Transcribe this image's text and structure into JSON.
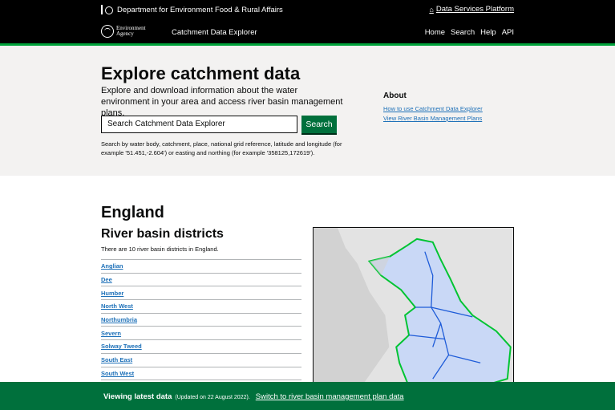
{
  "top_bar": {
    "department": "Department for Environment Food & Rural Affairs",
    "platform_link": "Data Services Platform"
  },
  "header": {
    "logo_text_line1": "Environment",
    "logo_text_line2": "Agency",
    "service_name": "Catchment Data Explorer",
    "nav": [
      "Home",
      "Search",
      "Help",
      "API"
    ]
  },
  "hero": {
    "title": "Explore catchment data",
    "lead": "Explore and download information about the water environment in your area and access river basin management plans.",
    "search_placeholder": "Search Catchment Data Explorer",
    "search_button": "Search",
    "hint": "Search by water body, catchment, place, national grid reference, latitude and longitude (for example '51.451,-2.604') or easting and northing (for example '358125,172619').",
    "about": {
      "title": "About",
      "links": [
        "How to use Catchment Data Explorer",
        "View River Basin Management Plans"
      ]
    }
  },
  "england": {
    "title": "England",
    "rbd_title": "River basin districts",
    "rbd_count": "There are 10 river basin districts in England.",
    "districts": [
      "Anglian",
      "Dee",
      "Humber",
      "North West",
      "Northumbria",
      "Severn",
      "Solway Tweed",
      "South East",
      "South West"
    ]
  },
  "banner": {
    "status": "Viewing latest data",
    "updated": "(Updated on 22 August 2022).",
    "switch_link": "Switch to river basin management plan data"
  },
  "colors": {
    "green": "#00703c",
    "link": "#1d70b8",
    "map_outline": "#00a33b",
    "map_rbd": "#1d5bd8"
  },
  "icons": {
    "crest": "royal-crest-icon",
    "home": "home-icon",
    "logo": "environment-agency-logo"
  }
}
